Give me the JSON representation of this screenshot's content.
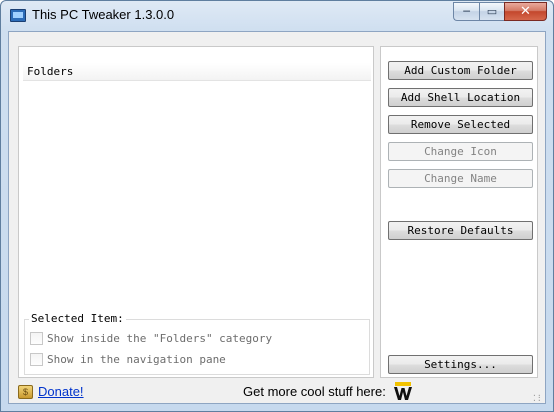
{
  "window": {
    "title": "This PC Tweaker 1.3.0.0",
    "caption_buttons": {
      "minimize": "─",
      "maximize": "▭",
      "close": "✕"
    }
  },
  "folders_list": {
    "header": "Folders"
  },
  "selected_item": {
    "label": "Selected Item:",
    "options": [
      {
        "label": "Show inside the \"Folders\" category",
        "checked": false,
        "enabled": false
      },
      {
        "label": "Show in the navigation pane",
        "checked": false,
        "enabled": false
      }
    ]
  },
  "buttons": {
    "add_custom_folder": "Add Custom Folder",
    "add_shell_location": "Add Shell Location",
    "remove_selected": "Remove Selected",
    "change_icon": "Change Icon",
    "change_name": "Change Name",
    "restore_defaults": "Restore Defaults",
    "settings": "Settings..."
  },
  "footer": {
    "donate_icon": "donate-icon",
    "donate_label": "Donate!",
    "promo_text": "Get more cool stuff here:",
    "logo_icon": "winaero-w-logo"
  },
  "colors": {
    "title_bar": "#cfdff0",
    "close_button": "#c3472c",
    "link": "#0033cc",
    "logo_yellow": "#f2c200"
  }
}
